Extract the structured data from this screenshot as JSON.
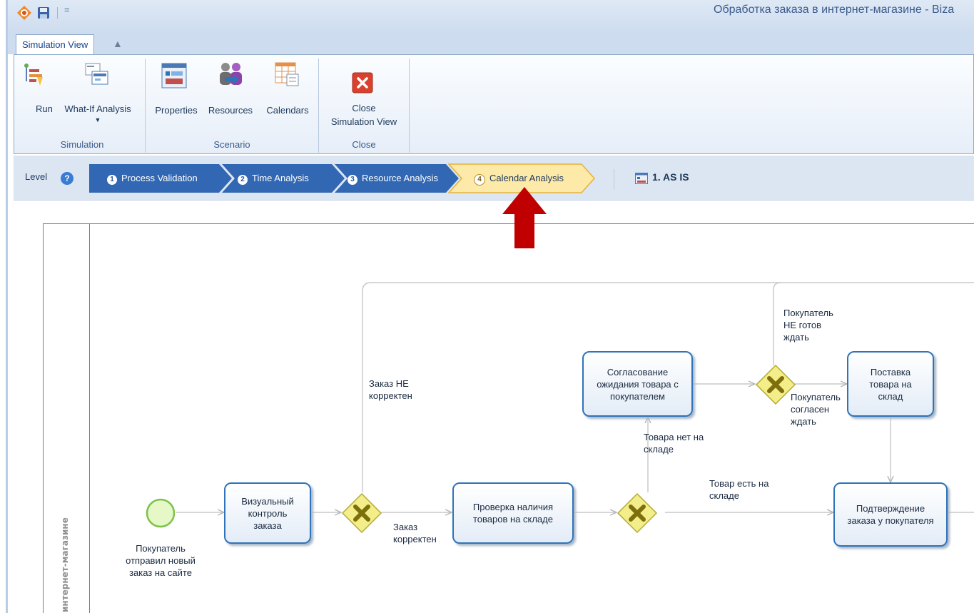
{
  "window": {
    "title": "Обработка заказа в интернет-магазине - Biza",
    "qat_dropdown": "="
  },
  "tabs": {
    "simulation_view": "Simulation View"
  },
  "ribbon": {
    "groups": [
      {
        "label": "Simulation",
        "buttons": [
          {
            "label": "Run",
            "icon": "run-icon"
          },
          {
            "label": "What-If Analysis",
            "icon": "what-if-icon",
            "has_dropdown": true
          }
        ]
      },
      {
        "label": "Scenario",
        "buttons": [
          {
            "label": "Properties",
            "icon": "properties-icon"
          },
          {
            "label": "Resources",
            "icon": "resources-icon"
          },
          {
            "label": "Calendars",
            "icon": "calendars-icon"
          }
        ]
      },
      {
        "label": "Close",
        "buttons": [
          {
            "label_line1": "Close",
            "label_line2": "Simulation View",
            "icon": "close-red-icon"
          }
        ]
      }
    ]
  },
  "level": {
    "label": "Level",
    "help": "?",
    "steps": [
      {
        "num": "1",
        "label": "Process Validation"
      },
      {
        "num": "2",
        "label": "Time Analysis"
      },
      {
        "num": "3",
        "label": "Resource Analysis"
      },
      {
        "num": "4",
        "label": "Calendar Analysis",
        "active": true
      }
    ],
    "scenario": "1. AS IS"
  },
  "diagram": {
    "lane_title": "интернет-магазине",
    "start_event_label": "Покупатель\nотправил новый\nзаказ на сайте",
    "tasks": {
      "visual_control": "Визуальный\nконтроль\nзаказа",
      "check_stock": "Проверка наличия\nтоваров на складе",
      "agree_wait": "Согласование\nожидания товара с\nпокупателем",
      "delivery": "Поставка\nтовара на\nсклад",
      "confirm": "Подтверждение\nзаказа у покупателя"
    },
    "flow_labels": {
      "order_not_correct": "Заказ НЕ\nкорректен",
      "order_correct": "Заказ\nкорректен",
      "no_stock": "Товара нет на\nскладе",
      "in_stock": "Товар есть на\nскладе",
      "not_ready_wait": "Покупатель\nНЕ готов\nждать",
      "agrees_wait": "Покупатель\nсогласен\nждать"
    }
  },
  "colors": {
    "task_border": "#2f73b8",
    "gateway_fill": "#f3ee8a",
    "start_event_fill": "#e6f7c8",
    "start_event_border": "#7ec24a",
    "active_step_fill": "#fde9a8",
    "step_fill": "#3167b3",
    "indicator_arrow": "#c00000"
  }
}
